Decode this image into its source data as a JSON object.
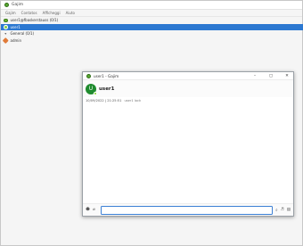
{
  "main_window": {
    "title": "Gajim",
    "menu": [
      "Gajim",
      "Contatos",
      "Afficheggi",
      "Aiuto"
    ]
  },
  "roster": {
    "account": "user1@fbaskerstauss (0/1)",
    "contact": "user1",
    "group": "General (0/1)",
    "admin": "admin"
  },
  "chat_window": {
    "title": "user1 - Gajim",
    "avatar_letter": "U",
    "contact_name": "user1",
    "messages": [
      {
        "time": "10/09/2022 | 21:25:51",
        "text": "user1 lock"
      }
    ],
    "input_placeholder": "",
    "window_buttons": [
      "–",
      "▢",
      "✕"
    ]
  },
  "colors": {
    "accent": "#2c78d1",
    "online_green": "#6bb52f",
    "avatar_bg": "#1f8b2e"
  }
}
